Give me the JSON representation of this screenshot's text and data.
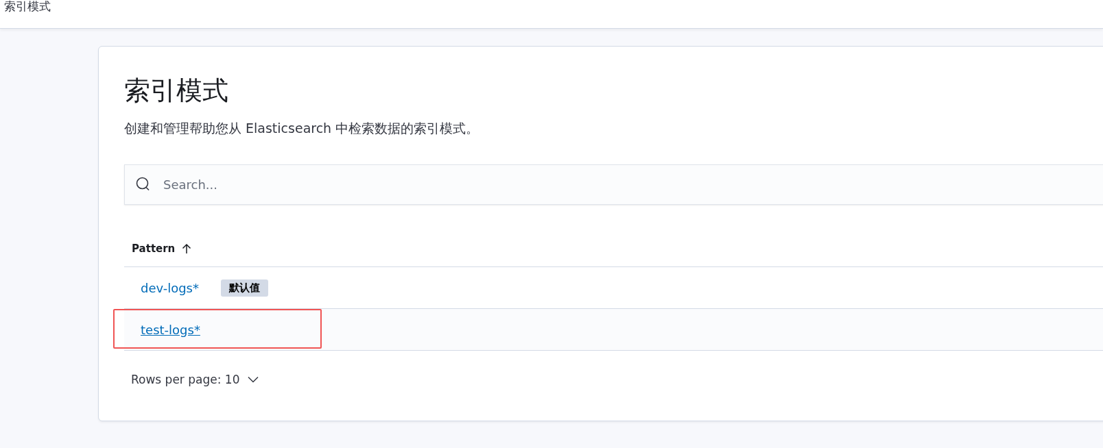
{
  "header": {
    "title": "索引模式"
  },
  "page": {
    "title": "索引模式",
    "description": "创建和管理帮助您从 Elasticsearch 中检索数据的索引模式。"
  },
  "search": {
    "placeholder": "Search..."
  },
  "table": {
    "columns": [
      {
        "label": "Pattern",
        "sorted": true
      }
    ],
    "rows": [
      {
        "pattern": "dev-logs*",
        "badge": "默认值",
        "hovered": false,
        "highlighted": false
      },
      {
        "pattern": "test-logs*",
        "hovered": true,
        "highlighted": true
      }
    ]
  },
  "pagination": {
    "rows_per_page": "Rows per page: 10"
  }
}
